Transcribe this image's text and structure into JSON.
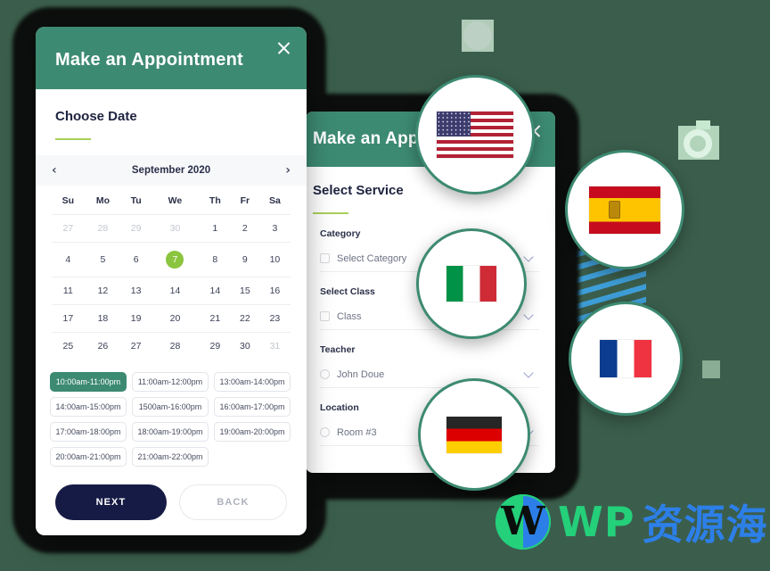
{
  "background": {
    "color": "#3b5e4c"
  },
  "modal_date": {
    "title": "Make an Appointment",
    "close_label": "×",
    "section_title": "Choose Date",
    "calendar": {
      "prev_label": "‹",
      "next_label": "›",
      "month_label": "September 2020",
      "weekdays": [
        "Su",
        "Mo",
        "Tu",
        "We",
        "Th",
        "Fr",
        "Sa"
      ],
      "weeks": [
        [
          {
            "d": "27",
            "muted": true
          },
          {
            "d": "28",
            "muted": true
          },
          {
            "d": "29",
            "muted": true
          },
          {
            "d": "30",
            "muted": true
          },
          {
            "d": "1"
          },
          {
            "d": "2"
          },
          {
            "d": "3"
          }
        ],
        [
          {
            "d": "4"
          },
          {
            "d": "5"
          },
          {
            "d": "6"
          },
          {
            "d": "7",
            "selected": true
          },
          {
            "d": "8"
          },
          {
            "d": "9"
          },
          {
            "d": "10"
          }
        ],
        [
          {
            "d": "11"
          },
          {
            "d": "12"
          },
          {
            "d": "13"
          },
          {
            "d": "14"
          },
          {
            "d": "14"
          },
          {
            "d": "15"
          },
          {
            "d": "16"
          }
        ],
        [
          {
            "d": "17"
          },
          {
            "d": "18"
          },
          {
            "d": "19"
          },
          {
            "d": "20"
          },
          {
            "d": "21"
          },
          {
            "d": "22"
          },
          {
            "d": "23"
          }
        ],
        [
          {
            "d": "25"
          },
          {
            "d": "26"
          },
          {
            "d": "27"
          },
          {
            "d": "28"
          },
          {
            "d": "29"
          },
          {
            "d": "30"
          },
          {
            "d": "31",
            "muted": true
          }
        ]
      ],
      "selected_day": "7",
      "selected_color": "#8bc53f"
    },
    "time_slots": [
      {
        "label": "10:00am-11:00pm",
        "selected": true
      },
      {
        "label": "11:00am-12:00pm",
        "selected": false
      },
      {
        "label": "13:00am-14:00pm",
        "selected": false
      },
      {
        "label": "14:00am-15:00pm",
        "selected": false
      },
      {
        "label": "1500am-16:00pm",
        "selected": false
      },
      {
        "label": "16:00am-17:00pm",
        "selected": false
      },
      {
        "label": "17:00am-18:00pm",
        "selected": false
      },
      {
        "label": "18:00am-19:00pm",
        "selected": false
      },
      {
        "label": "19:00am-20:00pm",
        "selected": false
      },
      {
        "label": "20:00am-21:00pm",
        "selected": false
      },
      {
        "label": "21:00am-22:00pm",
        "selected": false
      }
    ],
    "next_label": "NEXT",
    "back_label": "BACK",
    "header_color": "#3d8a72",
    "next_color": "#161b45"
  },
  "modal_service": {
    "title": "Make an Appo",
    "close_label": "×",
    "section_title": "Select Service",
    "fields": [
      {
        "label": "Category",
        "value": "Select Category"
      },
      {
        "label": "Select Class",
        "value": "Class"
      },
      {
        "label": "Teacher",
        "value": "John Doue"
      },
      {
        "label": "Location",
        "value": "Room #3"
      }
    ]
  },
  "flags": [
    {
      "name": "united-states",
      "code": "us"
    },
    {
      "name": "spain",
      "code": "es"
    },
    {
      "name": "italy",
      "code": "it"
    },
    {
      "name": "france",
      "code": "fr"
    },
    {
      "name": "germany",
      "code": "de"
    }
  ],
  "watermark": {
    "wp_text": "WP",
    "cn_text": "资源海",
    "logo_glyph": "W",
    "wp_color": "#24d07a",
    "cn_color": "#2d7fe8"
  }
}
